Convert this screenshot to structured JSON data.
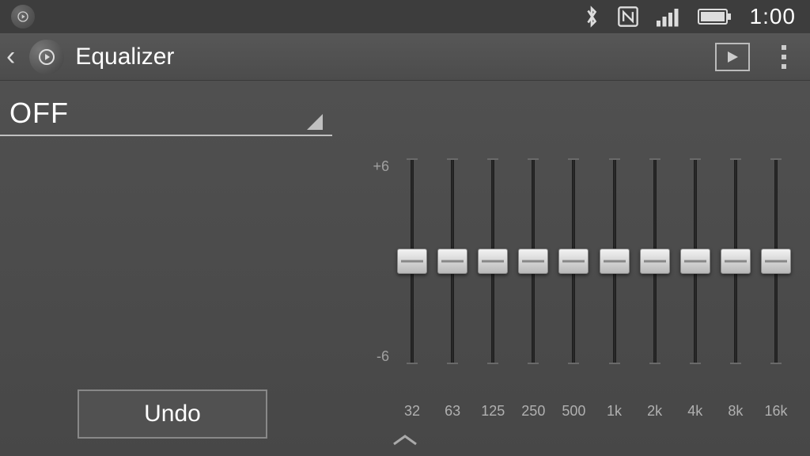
{
  "status": {
    "time": "1:00"
  },
  "actionbar": {
    "title": "Equalizer"
  },
  "preset": {
    "label": "OFF"
  },
  "buttons": {
    "undo": "Undo"
  },
  "eq": {
    "scale_max": "+6",
    "scale_min": "-6",
    "bands": [
      "32",
      "63",
      "125",
      "250",
      "500",
      "1k",
      "2k",
      "4k",
      "8k",
      "16k"
    ]
  },
  "chart_data": {
    "type": "bar",
    "title": "Equalizer",
    "categories": [
      "32",
      "63",
      "125",
      "250",
      "500",
      "1k",
      "2k",
      "4k",
      "8k",
      "16k"
    ],
    "values": [
      0,
      0,
      0,
      0,
      0,
      0,
      0,
      0,
      0,
      0
    ],
    "xlabel": "",
    "ylabel": "",
    "ylim": [
      -6,
      6
    ]
  }
}
